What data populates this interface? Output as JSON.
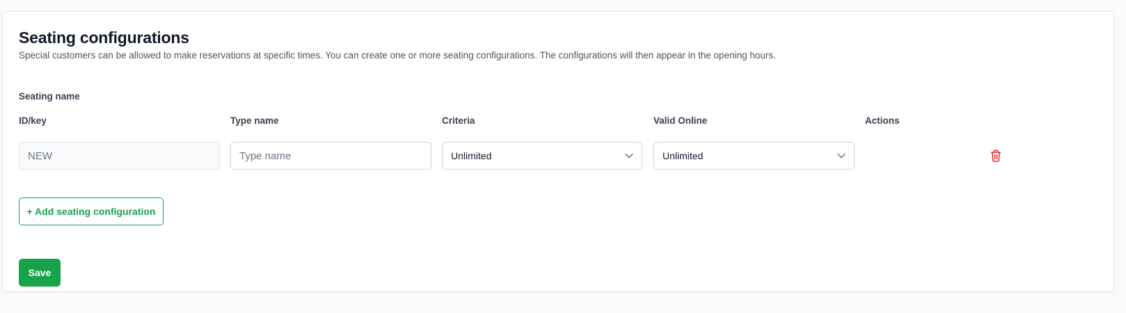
{
  "section": {
    "title": "Seating configurations",
    "description": "Special customers can be allowed to make reservations at specific times. You can create one or more seating configurations. The configurations will then appear in the opening hours.",
    "group_label": "Seating name"
  },
  "columns": {
    "id_key": "ID/key",
    "type_name": "Type name",
    "criteria": "Criteria",
    "valid_online": "Valid Online",
    "actions": "Actions"
  },
  "row": {
    "id_value": "NEW",
    "type_name_value": "",
    "type_name_placeholder": "Type name",
    "criteria_value": "Unlimited",
    "valid_online_value": "Unlimited",
    "delete_icon": "trash-icon"
  },
  "buttons": {
    "add_label": "+ Add seating configuration",
    "save_label": "Save"
  },
  "colors": {
    "accent": "#16a34a",
    "danger": "#dc2626"
  }
}
